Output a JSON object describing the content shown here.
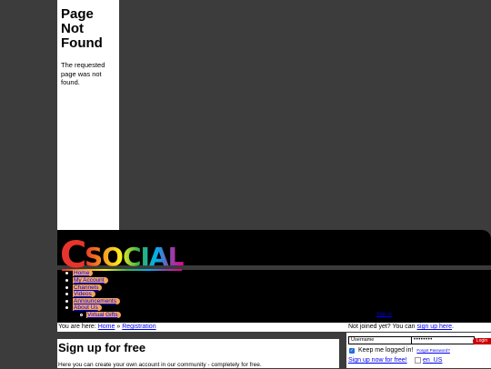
{
  "not_found": {
    "title": "Page Not Found",
    "message": "The requested page was not found."
  },
  "logo": {
    "text": "CSOCIAL",
    "colors": [
      "#e8352b",
      "#f7941d",
      "#fcee21",
      "#39b54a",
      "#00aeef",
      "#8e44ad",
      "#ec008c"
    ]
  },
  "nav": {
    "items": [
      {
        "label": "Home"
      },
      {
        "label": "My Account"
      },
      {
        "label": "Channels"
      },
      {
        "label": "Videos"
      },
      {
        "label": "Announcements"
      },
      {
        "label": "About Us"
      }
    ],
    "sub_items": [
      {
        "label": "Virtual Gifts"
      }
    ],
    "signin": "Sign in"
  },
  "breadcrumb": {
    "prefix": "You are here:",
    "home": "Home",
    "separator": "»",
    "current": "Registration"
  },
  "notjoined": {
    "text": "Not joined yet? You can",
    "link": "sign up here",
    "end": "."
  },
  "main": {
    "title": "Sign up for free",
    "intro": "Here you can create your own account in our community - completely for free."
  },
  "login": {
    "username_value": "Username",
    "password_value": "••••••••",
    "button_label": "Login",
    "remember_label": "Keep me logged in!",
    "remember_checked": true,
    "forgot_label": "Forgot Password?",
    "signup_now": "Sign up now for free!",
    "language": "en_US"
  },
  "colors": {
    "background": "#3c3c3c",
    "nav_pill": "#f4a460",
    "link": "#0000ee",
    "login_button": "#cc0000"
  }
}
